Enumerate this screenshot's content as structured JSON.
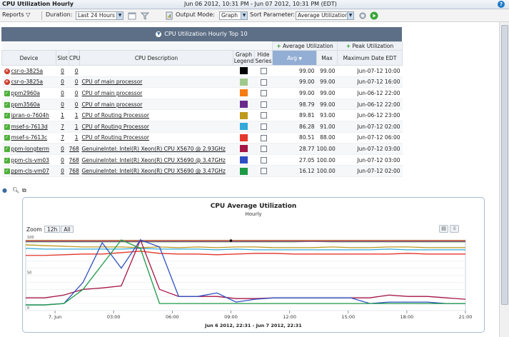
{
  "window": {
    "title": "CPU Utilization Hourly",
    "date_range": "Jun 06 2012, 10:31 PM - Jun 07 2012, 10:31 PM (EDT)",
    "help": "?"
  },
  "toolbar": {
    "reports": "Reports",
    "duration_label": "Duration:",
    "duration_value": "Last 24 Hours",
    "output_mode_label": "Output Mode:",
    "output_mode_value": "Graph",
    "sort_param_label": "Sort Parameter:",
    "sort_param_value": "Average Utilization"
  },
  "grid": {
    "title": "CPU Utilization Hourly Top 10",
    "group_headers": {
      "avg": "Average Utilization",
      "peak": "Peak Utilization"
    },
    "columns": {
      "device": "Device",
      "slot": "Slot",
      "cpu": "CPU",
      "desc": "CPU Description",
      "legend": "Graph Legend",
      "hide": "Hide Series",
      "avg": "Avg",
      "max": "Max",
      "maxdate": "Maximum Date EDT"
    },
    "rows": [
      {
        "status": "error",
        "device": "csr-o-3825a",
        "slot": "0",
        "cpu": "0",
        "desc": "",
        "color": "#000000",
        "avg": "99.00",
        "max": "99.00",
        "date": "Jun-07-12 10:00"
      },
      {
        "status": "error",
        "device": "csr-o-3825a",
        "slot": "0",
        "cpu": "0",
        "desc": "CPU of main processor",
        "color": "#9fc98c",
        "avg": "99.00",
        "max": "99.00",
        "date": "Jun-07-12 16:00"
      },
      {
        "status": "ok",
        "device": "ppm2960a",
        "slot": "0",
        "cpu": "0",
        "desc": "CPU of main processor",
        "color": "#f57c12",
        "avg": "99.00",
        "max": "99.00",
        "date": "Jun-06-12 22:00"
      },
      {
        "status": "ok",
        "device": "ppm3560a",
        "slot": "0",
        "cpu": "0",
        "desc": "CPU of main processor",
        "color": "#6a2a8c",
        "avg": "98.79",
        "max": "99.00",
        "date": "Jun-06-12 22:00"
      },
      {
        "status": "ok",
        "device": "ipran-o-7604h",
        "slot": "1",
        "cpu": "1",
        "desc": "CPU of Routing Processor",
        "color": "#bc9a1e",
        "avg": "89.81",
        "max": "93.00",
        "date": "Jun-06-12 23:00"
      },
      {
        "status": "ok",
        "device": "msef-s-7613d",
        "slot": "7",
        "cpu": "1",
        "desc": "CPU of Routing Processor",
        "color": "#32a9d8",
        "avg": "86.28",
        "max": "91.00",
        "date": "Jun-07-12 02:00"
      },
      {
        "status": "ok",
        "device": "msef-s-7613c",
        "slot": "7",
        "cpu": "1",
        "desc": "CPU of Routing Processor",
        "color": "#e5372d",
        "avg": "80.51",
        "max": "88.00",
        "date": "Jun-07-12 06:00"
      },
      {
        "status": "ok",
        "device": "ppm-longterm",
        "slot": "0",
        "cpu": "768",
        "desc": "GenuineIntel: Intel(R) Xeon(R) CPU X5670 @ 2.93GHz",
        "color": "#a51546",
        "avg": "28.77",
        "max": "100.00",
        "date": "Jun-07-12 03:00"
      },
      {
        "status": "ok",
        "device": "ppm-cls-vm03",
        "slot": "0",
        "cpu": "768",
        "desc": "GenuineIntel: Intel(R) Xeon(R) CPU X5690 @ 3.47GHz",
        "color": "#2e4fc4",
        "avg": "27.05",
        "max": "100.00",
        "date": "Jun-07-12 03:00"
      },
      {
        "status": "ok",
        "device": "ppm-cls-vm07",
        "slot": "0",
        "cpu": "768",
        "desc": "GenuineIntel: Intel(R) Xeon(R) CPU X5690 @ 3.47GHz",
        "color": "#1c9a45",
        "avg": "16.12",
        "max": "100.00",
        "date": "Jun-07-12 02:00"
      }
    ]
  },
  "chart_panel": {
    "zoom_label": "Zoom",
    "zoom_options": [
      "12h",
      "All"
    ]
  },
  "chart_data": {
    "type": "line",
    "title": "CPU Average Utilization",
    "subtitle": "Hourly",
    "xlabel": "Jun 6 2012, 22:31 - Jun 7 2012, 22:31",
    "x_tick_labels": [
      "7. Jun",
      "03:00",
      "06:00",
      "09:00",
      "12:00",
      "15:00",
      "18:00",
      "21:00"
    ],
    "x_tick_positions_hours": [
      1.5,
      4.5,
      7.5,
      10.5,
      13.5,
      16.5,
      19.5,
      22.5
    ],
    "y_tick_labels": [
      "0",
      "50",
      "100"
    ],
    "ylim": [
      0,
      100
    ],
    "xlim_hours": [
      0,
      22.5
    ],
    "series": [
      {
        "color": "#000000",
        "values": [
          99,
          99,
          99,
          99,
          99,
          99,
          99,
          99,
          99,
          99,
          99,
          99,
          99,
          99,
          99,
          99,
          99,
          99,
          99,
          99,
          99,
          99,
          99,
          99
        ]
      },
      {
        "color": "#9fc98c",
        "values": [
          97,
          97,
          97,
          97,
          97,
          97,
          97,
          97,
          97,
          97,
          97,
          97,
          97,
          97,
          97,
          98,
          97,
          97,
          97,
          97,
          97,
          97,
          97,
          97
        ]
      },
      {
        "color": "#f57c12",
        "values": [
          99,
          99,
          99,
          99,
          99,
          99,
          99,
          99,
          99,
          99,
          99,
          99,
          99,
          99,
          99,
          99,
          99,
          99,
          99,
          99,
          99,
          99,
          99,
          99
        ]
      },
      {
        "color": "#6a2a8c",
        "values": [
          98,
          98,
          98,
          98,
          98,
          98,
          98,
          98,
          98,
          98,
          98,
          98,
          98,
          98,
          98,
          98,
          98,
          98,
          98,
          98,
          98,
          98,
          98,
          98
        ]
      },
      {
        "color": "#bc9a1e",
        "values": [
          93,
          92,
          91,
          90,
          90,
          90,
          89,
          90,
          89,
          90,
          89,
          90,
          90,
          89,
          89,
          89,
          90,
          89,
          89,
          90,
          90,
          89,
          89,
          89
        ]
      },
      {
        "color": "#32a9d8",
        "values": [
          88,
          87,
          87,
          87,
          87,
          87,
          88,
          87,
          87,
          87,
          86,
          87,
          86,
          86,
          86,
          86,
          86,
          86,
          86,
          87,
          86,
          86,
          86,
          86
        ]
      },
      {
        "color": "#e5372d",
        "values": [
          78,
          78,
          79,
          80,
          80,
          82,
          84,
          81,
          80,
          80,
          79,
          80,
          81,
          81,
          80,
          80,
          80,
          80,
          80,
          80,
          81,
          80,
          80,
          80
        ]
      },
      {
        "color": "#a51546",
        "values": [
          18,
          18,
          22,
          30,
          32,
          35,
          100,
          30,
          20,
          20,
          20,
          17,
          17,
          18,
          18,
          18,
          18,
          18,
          18,
          22,
          20,
          20,
          18,
          16
        ]
      },
      {
        "color": "#2e4fc4",
        "values": [
          8,
          8,
          10,
          40,
          96,
          60,
          100,
          90,
          20,
          20,
          25,
          12,
          16,
          18,
          18,
          18,
          18,
          18,
          10,
          12,
          12,
          12,
          10,
          10
        ]
      },
      {
        "color": "#1c9a45",
        "values": [
          8,
          8,
          10,
          30,
          65,
          100,
          88,
          10,
          10,
          10,
          10,
          10,
          10,
          10,
          10,
          10,
          10,
          10,
          10,
          10,
          10,
          10,
          10,
          10
        ]
      }
    ]
  }
}
